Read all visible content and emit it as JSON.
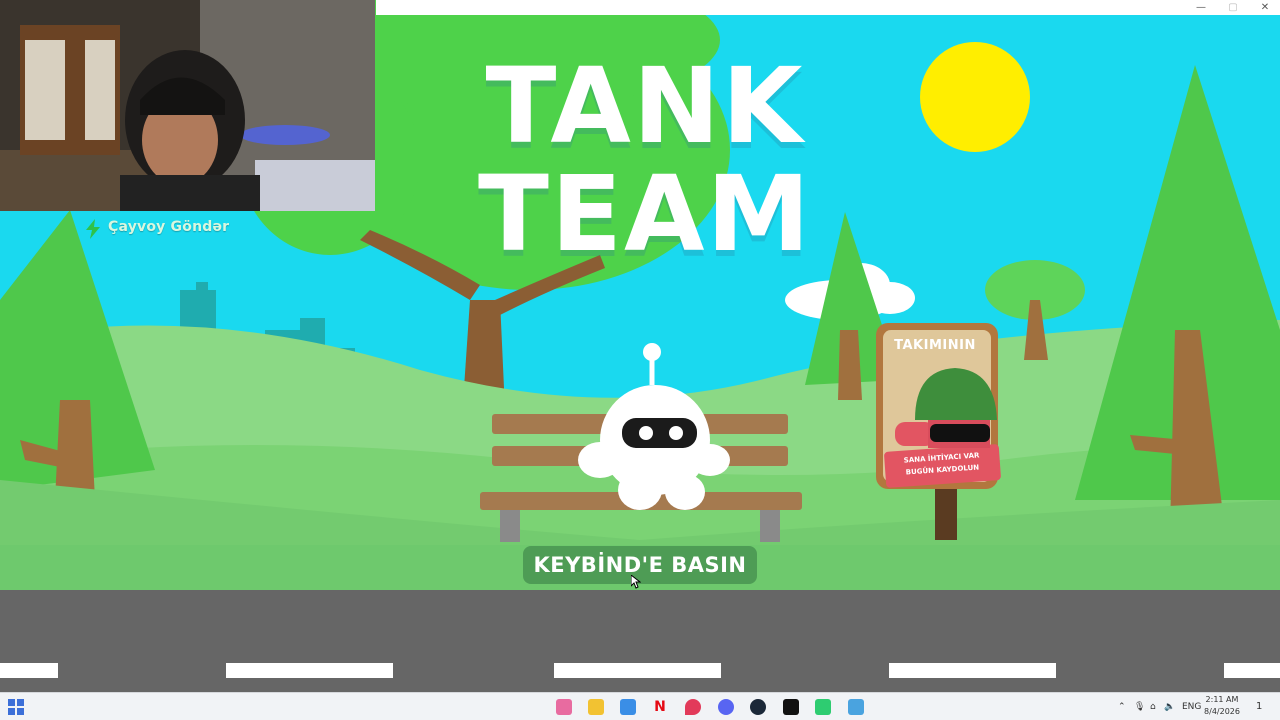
{
  "game": {
    "title_line1": "TANK",
    "title_line2": "TEAM",
    "cta_label": "KEYBİND'E BASIN",
    "sign": {
      "top": "TAKIMININ",
      "bottom_line1": "SANA İHTİYACI VAR",
      "bottom_line2": "BUGÜN KAYDOLUN"
    }
  },
  "overlay": {
    "streamer_name": "Çayvoy Göndər"
  },
  "window": {
    "minimize": "—",
    "maximize": "▢",
    "close": "✕"
  },
  "taskbar": {
    "apps": [
      "paint-icon",
      "file-explorer-icon",
      "store-icon",
      "netflix-icon",
      "pin-icon",
      "discord-icon",
      "steam-icon",
      "terminal-icon",
      "capture-icon",
      "game-icon"
    ],
    "netflix_letter": "N",
    "lang": "ENG",
    "time": "2:11 AM",
    "date": "8/4/2026",
    "notification_count": "1",
    "colors": {
      "sky": "#1ad9ef",
      "grass": "#6ec96d",
      "road": "#666666",
      "button": "#4e9c55",
      "sign_red": "#e25562"
    }
  }
}
